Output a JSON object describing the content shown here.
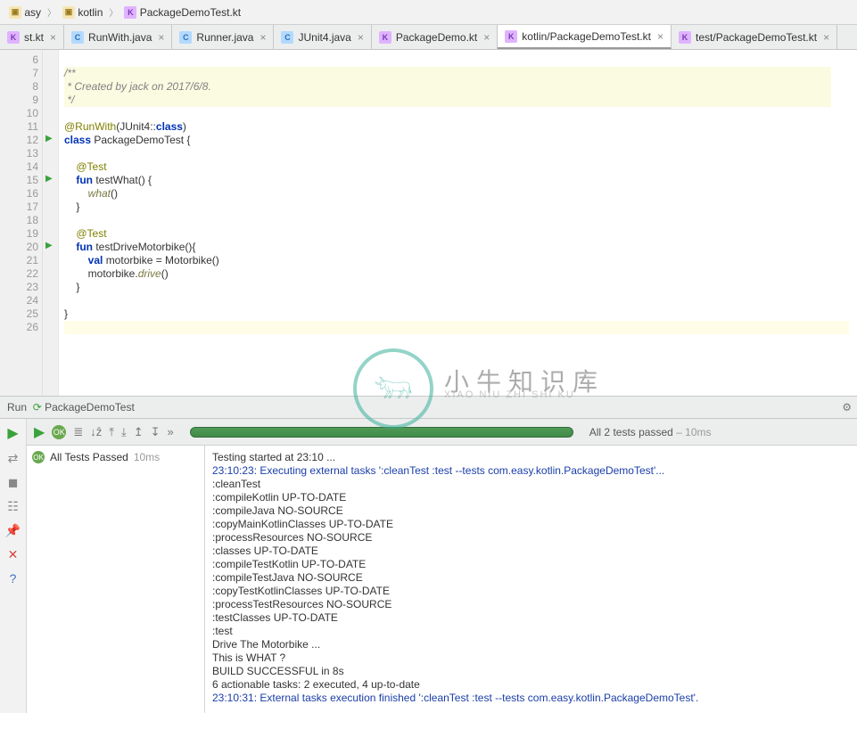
{
  "breadcrumb": [
    "asy",
    "kotlin",
    "PackageDemoTest.kt"
  ],
  "tabs": [
    {
      "label": "st.kt",
      "icon": "kt",
      "active": false
    },
    {
      "label": "RunWith.java",
      "icon": "java",
      "active": false
    },
    {
      "label": "Runner.java",
      "icon": "java",
      "active": false
    },
    {
      "label": "JUnit4.java",
      "icon": "java",
      "active": false
    },
    {
      "label": "PackageDemo.kt",
      "icon": "kt",
      "active": false
    },
    {
      "label": "kotlin/PackageDemoTest.kt",
      "icon": "kt",
      "active": true
    },
    {
      "label": "test/PackageDemoTest.kt",
      "icon": "kt",
      "active": false
    }
  ],
  "line_numbers": [
    "6",
    "7",
    "8",
    "9",
    "10",
    "11",
    "12",
    "13",
    "14",
    "15",
    "16",
    "17",
    "18",
    "19",
    "20",
    "21",
    "22",
    "23",
    "24",
    "25",
    "26"
  ],
  "run_markers": {
    "12": true,
    "15": true,
    "20": true
  },
  "code": {
    "l7": "/**",
    "l8": " * Created by jack on 2017/6/8.",
    "l9": " */",
    "l11a": "@RunWith",
    "l11b": "(JUnit4::",
    "l11c": "class",
    "l11d": ")",
    "l12a": "class ",
    "l12b": "PackageDemoTest {",
    "l14": "@Test",
    "l15a": "fun ",
    "l15b": "testWhat",
    "l15c": "() {",
    "l16a": "        ",
    "l16b": "what",
    "l16c": "()",
    "l17": "    }",
    "l19": "@Test",
    "l20a": "fun ",
    "l20b": "testDriveMotorbike",
    "l20c": "(){",
    "l21a": "        ",
    "l21b": "val ",
    "l21c": "motorbike = Motorbike()",
    "l22a": "        motorbike.",
    "l22b": "drive",
    "l22c": "()",
    "l23": "    }",
    "l25": "}"
  },
  "watermark": {
    "big": "小牛知识库",
    "small": "XIAO NIU ZHI SHI KU"
  },
  "run": {
    "panel_title": "Run",
    "target": "PackageDemoTest",
    "status": "All 2 tests passed",
    "status_time": " – 10ms",
    "tree_label": "All Tests Passed",
    "tree_time": "10ms"
  },
  "console": [
    {
      "t": "Testing started at 23:10 ...",
      "c": ""
    },
    {
      "t": "23:10:23: Executing external tasks ':cleanTest :test --tests com.easy.kotlin.PackageDemoTest'...",
      "c": "bl"
    },
    {
      "t": ":cleanTest",
      "c": ""
    },
    {
      "t": ":compileKotlin UP-TO-DATE",
      "c": ""
    },
    {
      "t": ":compileJava NO-SOURCE",
      "c": ""
    },
    {
      "t": ":copyMainKotlinClasses UP-TO-DATE",
      "c": ""
    },
    {
      "t": ":processResources NO-SOURCE",
      "c": ""
    },
    {
      "t": ":classes UP-TO-DATE",
      "c": ""
    },
    {
      "t": ":compileTestKotlin UP-TO-DATE",
      "c": ""
    },
    {
      "t": ":compileTestJava NO-SOURCE",
      "c": ""
    },
    {
      "t": ":copyTestKotlinClasses UP-TO-DATE",
      "c": ""
    },
    {
      "t": ":processTestResources NO-SOURCE",
      "c": ""
    },
    {
      "t": ":testClasses UP-TO-DATE",
      "c": ""
    },
    {
      "t": ":test",
      "c": ""
    },
    {
      "t": "Drive The Motorbike ...",
      "c": ""
    },
    {
      "t": "This is WHAT ?",
      "c": ""
    },
    {
      "t": "BUILD SUCCESSFUL in 8s",
      "c": ""
    },
    {
      "t": "6 actionable tasks: 2 executed, 4 up-to-date",
      "c": ""
    },
    {
      "t": "23:10:31: External tasks execution finished ':cleanTest :test --tests com.easy.kotlin.PackageDemoTest'.",
      "c": "bl"
    }
  ]
}
